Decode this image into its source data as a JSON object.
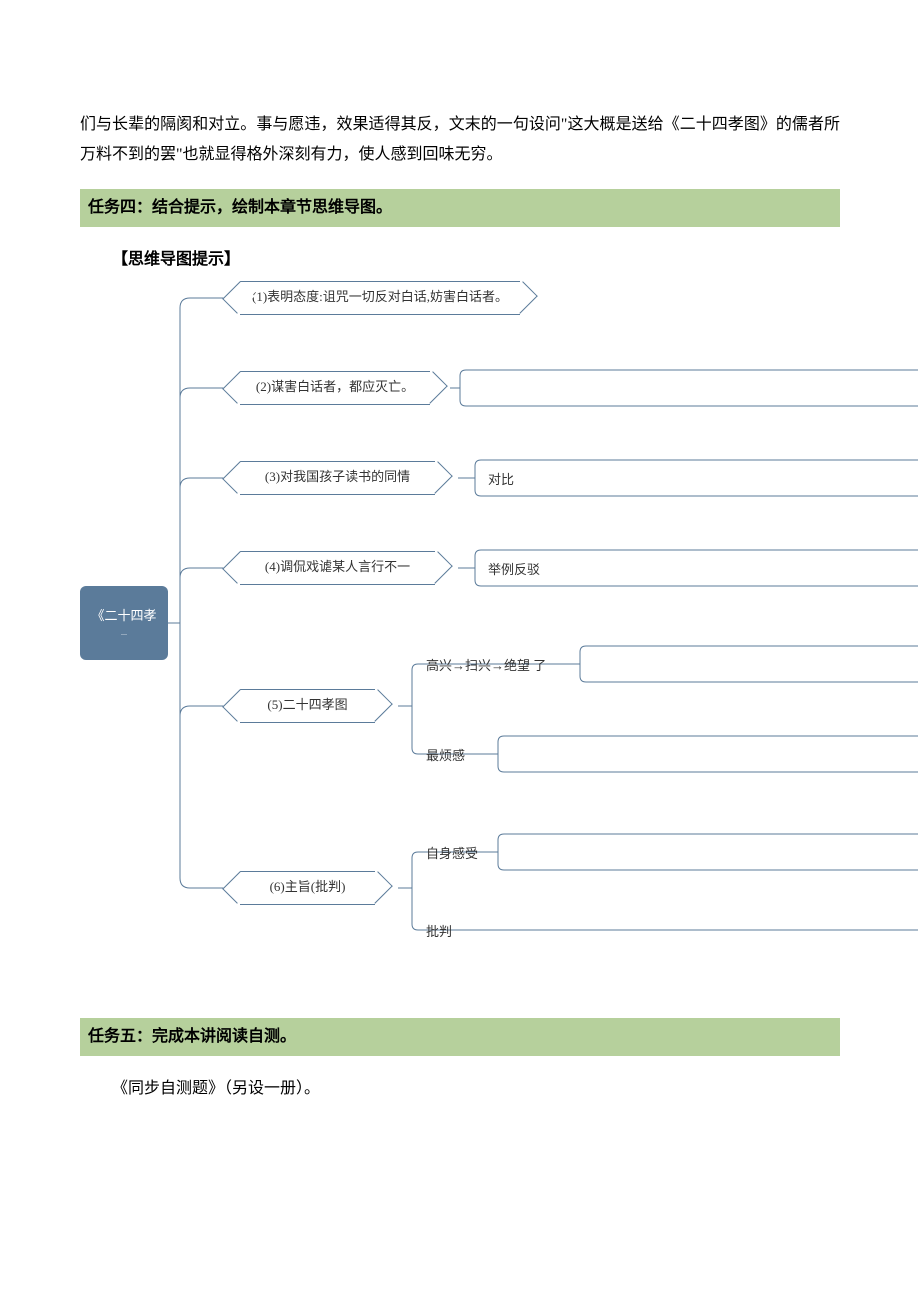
{
  "intro": "们与长辈的隔阂和对立。事与愿违，效果适得其反，文末的一句设问\"这大概是送给《二十四孝图》的儒者所万料不到的罢\"也就显得格外深刻有力，使人感到回味无穷。",
  "task4": "任务四：结合提示，绘制本章节思维导图。",
  "hintLabel": "【思维导图提示】",
  "root": "《二十四孝",
  "rootSub": "...",
  "nodes": {
    "n1": "(1)表明态度:诅咒一切反对白话,妨害白话者。",
    "n2": "(2)谋害白话者，都应灭亡。",
    "n3": "(3)对我国孩子读书的同情",
    "n4": "(4)调侃戏谑某人言行不一",
    "n5": "(5)二十四孝图",
    "n6": "(6)主旨(批判)"
  },
  "labels": {
    "l3": "对比",
    "l4": "举例反驳",
    "l5a": "高兴→扫兴→绝望 了",
    "l5b": "最烦感",
    "l6a": "自身感受",
    "l6b": "批判"
  },
  "task5": "任务五：完成本讲阅读自测。",
  "footer": "《同步自测题》（另设一册）。"
}
